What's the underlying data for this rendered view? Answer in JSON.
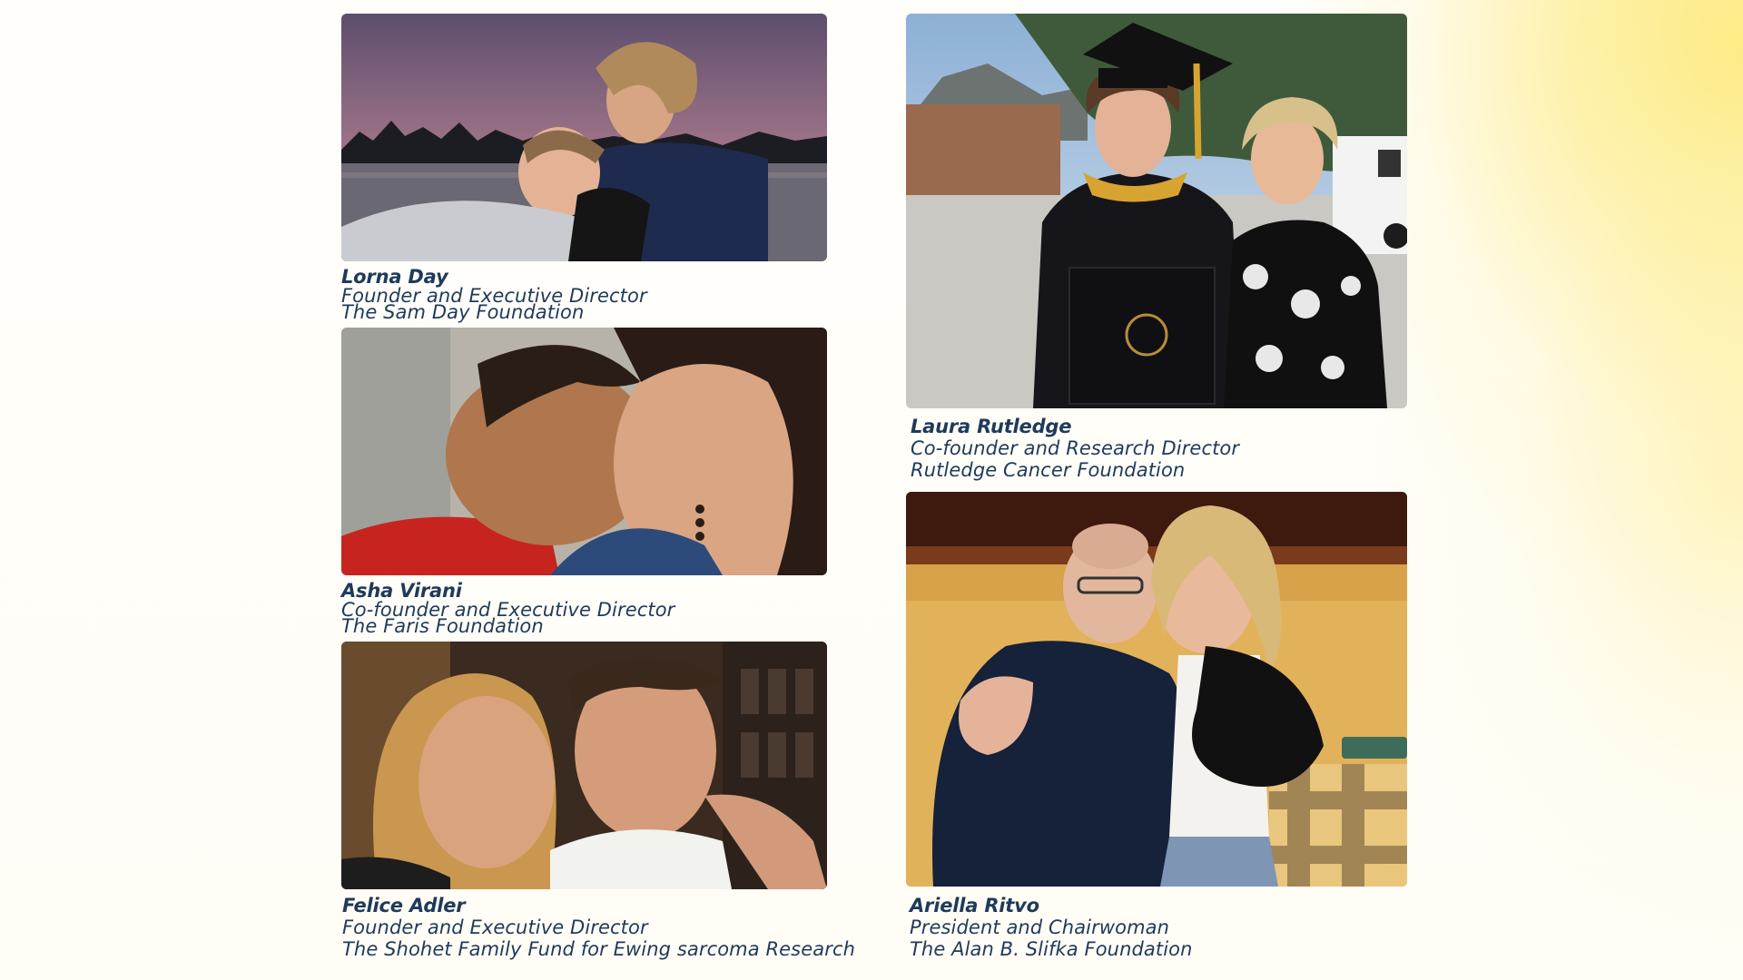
{
  "people": [
    {
      "name": "Lorna Day",
      "role": "Founder and Executive Director",
      "org": "The Sam Day Foundation",
      "photo_desc": "Woman holding a young boy in a boat at sunset on a lake"
    },
    {
      "name": "Asha Virani",
      "role": "Co-founder and Executive Director",
      "org": "The Faris Foundation",
      "photo_desc": "Close-up of a smiling boy leaning against a smiling woman"
    },
    {
      "name": "Felice Adler",
      "role": "Founder and Executive Director",
      "org": "The Shohet Family Fund for Ewing sarcoma Research",
      "photo_desc": "Selfie of a smiling woman and young man"
    },
    {
      "name": "Laura Rutledge",
      "role": "Co-founder and Research Director",
      "org": "Rutledge Cancer Foundation",
      "photo_desc": "Graduate in cap and gown holding diploma next to a woman"
    },
    {
      "name": "Ariella Ritvo",
      "role": "President and Chairwoman",
      "org": "The Alan B. Slifka Foundation",
      "photo_desc": "Woman and young man hugging on a couch"
    }
  ],
  "colors": {
    "caption_text": "#1f3a5a",
    "background_glow": "#fde978"
  }
}
